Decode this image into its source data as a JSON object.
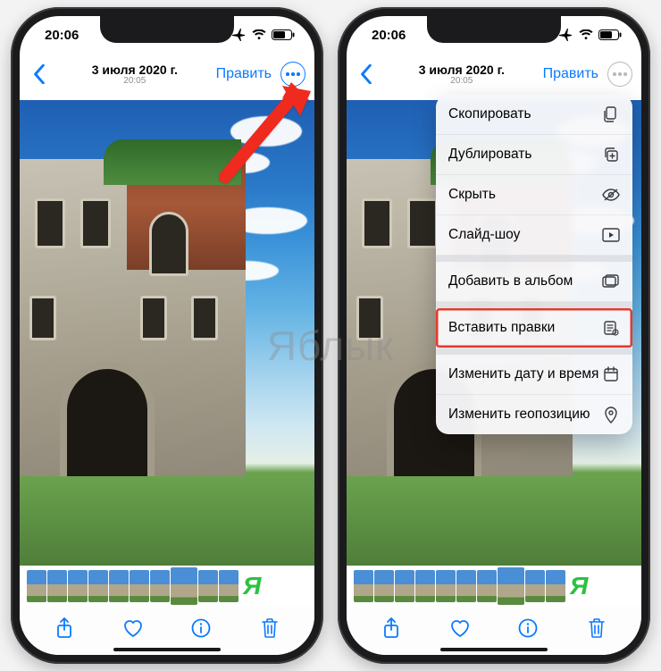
{
  "status": {
    "time": "20:06"
  },
  "nav": {
    "date": "3 июля 2020 г.",
    "time": "20:05",
    "edit_label": "Править"
  },
  "toolbar": {
    "share": "share",
    "like": "heart",
    "info": "info",
    "trash": "trash"
  },
  "menu": {
    "items": [
      {
        "label": "Скопировать",
        "icon": "copy"
      },
      {
        "label": "Дублировать",
        "icon": "duplicate"
      },
      {
        "label": "Скрыть",
        "icon": "eye-off"
      },
      {
        "label": "Слайд-шоу",
        "icon": "play-rect"
      },
      {
        "label": "Добавить в альбом",
        "icon": "album-add"
      },
      {
        "label": "Вставить правки",
        "icon": "paste-edits",
        "highlight": true
      },
      {
        "label": "Изменить дату и время",
        "icon": "calendar"
      },
      {
        "label": "Изменить геопозицию",
        "icon": "pin"
      }
    ],
    "group_break_after": [
      4,
      5
    ]
  },
  "thumb_badge": "Я",
  "watermark": "Яблык"
}
